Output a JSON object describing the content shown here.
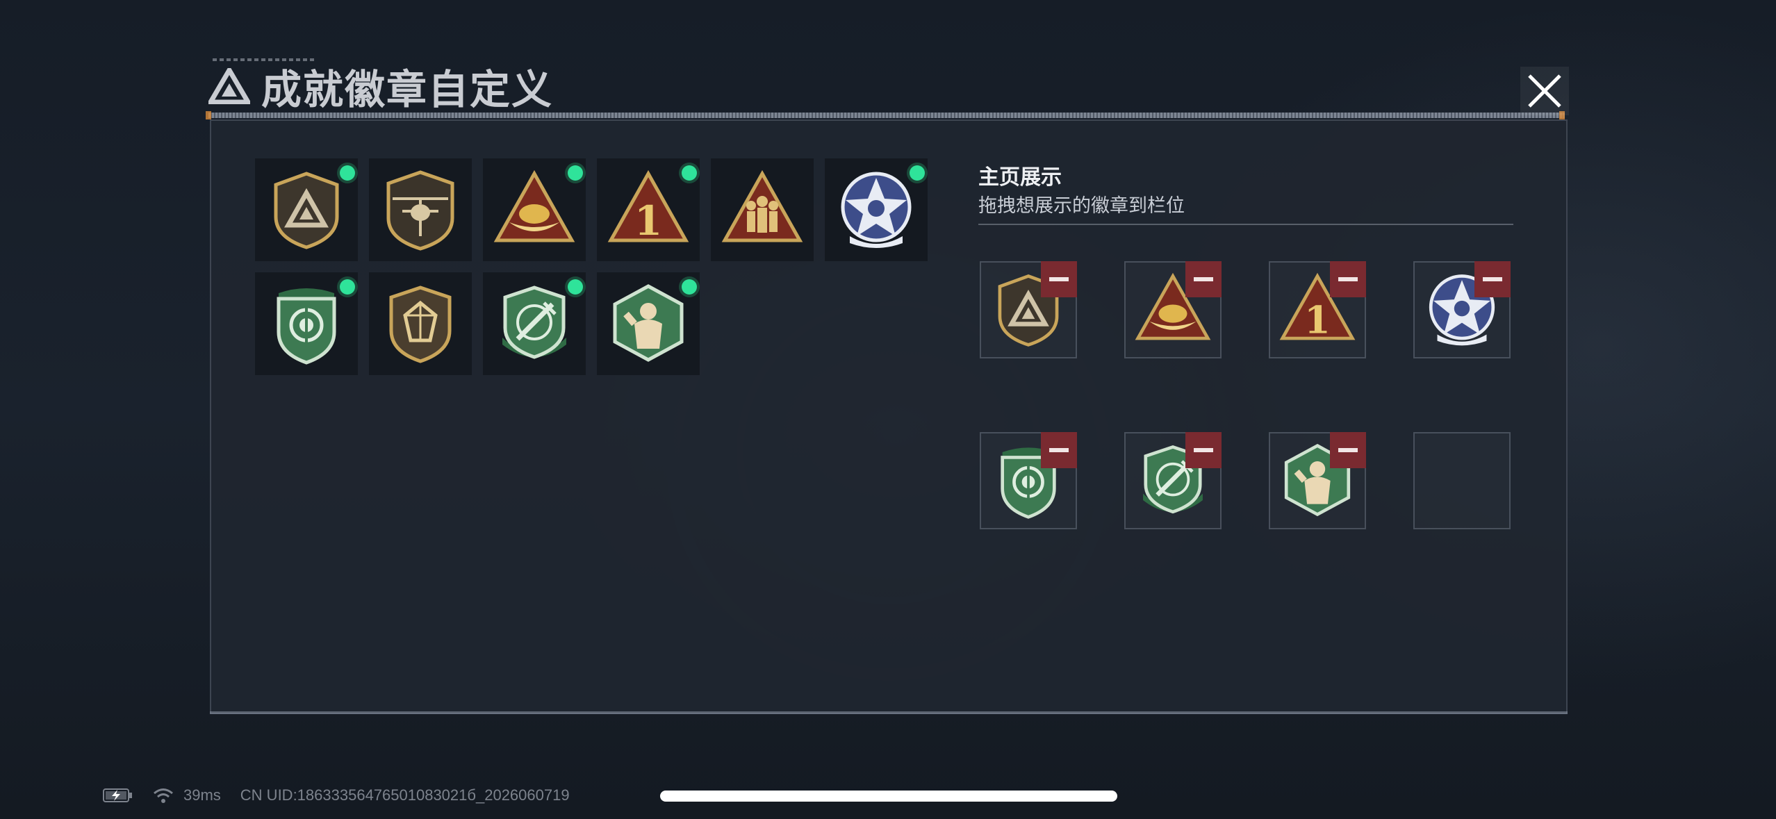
{
  "header": {
    "title": "成就徽章自定义",
    "logo_icon": "triangle-logo-icon",
    "close_icon": "close-icon"
  },
  "badges": [
    {
      "name": "shield-triangle",
      "equipped": true
    },
    {
      "name": "helicopter",
      "equipped": false
    },
    {
      "name": "triangle-bowl",
      "equipped": true
    },
    {
      "name": "triangle-number-one",
      "equipped": true
    },
    {
      "name": "triangle-soldiers",
      "equipped": false
    },
    {
      "name": "star-skull",
      "equipped": true
    },
    {
      "name": "green-shield-target",
      "equipped": true
    },
    {
      "name": "gem-shield",
      "equipped": false
    },
    {
      "name": "green-crossed-sword",
      "equipped": true
    },
    {
      "name": "green-hexagon-fighter",
      "equipped": true
    }
  ],
  "display": {
    "title": "主页展示",
    "subtitle": "拖拽想展示的徽章到栏位",
    "slots": [
      {
        "badge": "shield-triangle"
      },
      {
        "badge": "triangle-bowl"
      },
      {
        "badge": "triangle-number-one"
      },
      {
        "badge": "star-skull"
      },
      {
        "badge": "green-shield-target"
      },
      {
        "badge": "green-crossed-sword"
      },
      {
        "badge": "green-hexagon-fighter"
      },
      {
        "badge": ""
      }
    ]
  },
  "status": {
    "ping": "39ms",
    "uid": "CN UID:18633356476501083021б_2026060719"
  },
  "colors": {
    "equipped_dot": "#2fe39a",
    "remove_button": "#7a2a30",
    "gold": "#c9a55a",
    "green": "#3d7a52",
    "panel": "#202630"
  }
}
